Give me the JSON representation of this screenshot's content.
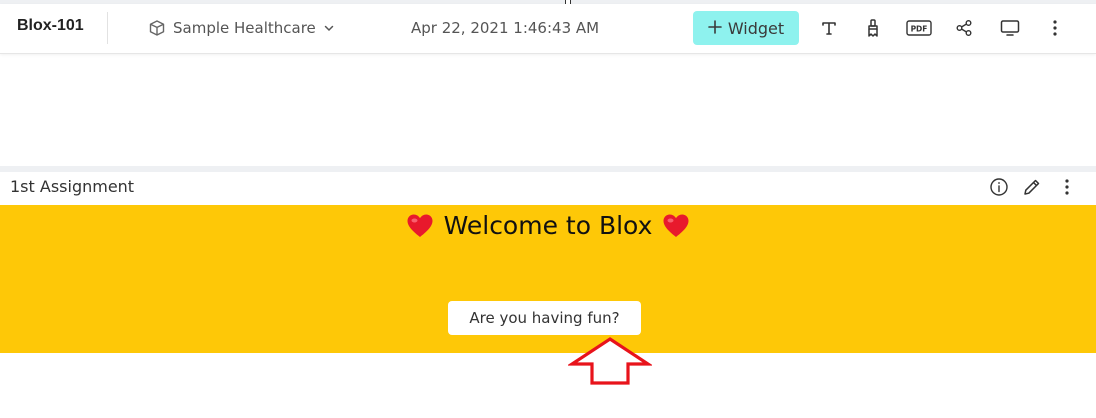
{
  "header": {
    "app_title": "Blox-101",
    "dataset": "Sample Healthcare",
    "timestamp": "Apr 22, 2021 1:46:43 AM",
    "widget_button": "Widget",
    "pdf_label": "PDF"
  },
  "widget": {
    "title": "1st Assignment",
    "welcome_text": "Welcome to Blox",
    "button_label": "Are you having fun?",
    "background_color": "#fec807"
  },
  "icons": [
    "cube-icon",
    "chevron-down-icon",
    "plus-icon",
    "text-icon",
    "paint-brush-icon",
    "pdf-icon",
    "share-icon",
    "monitor-icon",
    "more-vertical-icon",
    "info-icon",
    "pencil-icon",
    "heart-icon",
    "arrow-up-icon"
  ],
  "colors": {
    "accent": "#8ef2ee",
    "annotation_arrow": "#e8131b",
    "heart": "#e8192c"
  }
}
